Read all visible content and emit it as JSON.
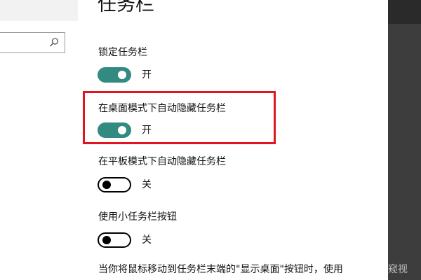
{
  "title": "任务栏",
  "search": {
    "value": ""
  },
  "settings": [
    {
      "label": "锁定任务栏",
      "state_text": "开",
      "on": true
    },
    {
      "label": "在桌面模式下自动隐藏任务栏",
      "state_text": "开",
      "on": true
    },
    {
      "label": "在平板模式下自动隐藏任务栏",
      "state_text": "关",
      "on": false
    },
    {
      "label": "使用小任务栏按钮",
      "state_text": "关",
      "on": false
    }
  ],
  "description": "当你将鼠标移动到任务栏末端的\"显示桌面\"按钮时，使用",
  "watermark": "窥视",
  "colors": {
    "toggle_on": "#338a80",
    "highlight": "#e0151f",
    "right_panel": "#3d3d3d"
  }
}
